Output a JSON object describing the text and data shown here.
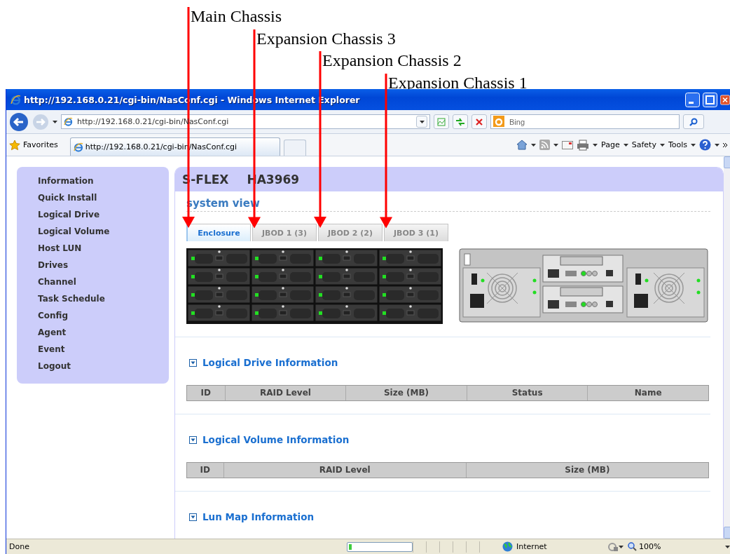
{
  "annotations": [
    {
      "label": "Main Chassis"
    },
    {
      "label": "Expansion Chassis 3"
    },
    {
      "label": "Expansion Chassis 2"
    },
    {
      "label": "Expansion Chassis 1"
    }
  ],
  "browser": {
    "title": "http://192.168.0.21/cgi-bin/NasConf.cgi - Windows Internet Explorer",
    "address": "http://192.168.0.21/cgi-bin/NasConf.cgi",
    "search_placeholder": "Bing",
    "favorites": "Favorites",
    "tab": "http://192.168.0.21/cgi-bin/NasConf.cgi",
    "commands": [
      "Page",
      "Safety",
      "Tools"
    ]
  },
  "sidebar": {
    "items": [
      "Information",
      "Quick Install",
      "Logical Drive",
      "Logical Volume",
      "Host LUN",
      "Drives",
      "Channel",
      "Task Schedule",
      "Config",
      "Agent",
      "Event",
      "Logout"
    ]
  },
  "header": {
    "brand": "S-FLEX",
    "model": "HA3969"
  },
  "system_view": {
    "title": "system view",
    "tabs": [
      {
        "label": "Enclosure",
        "selected": true
      },
      {
        "label": "JBOD 1 (3)",
        "selected": false
      },
      {
        "label": "JBOD 2 (2)",
        "selected": false
      },
      {
        "label": "JBOD 3 (1)",
        "selected": false
      }
    ]
  },
  "sections": [
    {
      "title": "Logical Drive Information",
      "columns": [
        "ID",
        "RAID Level",
        "Size (MB)",
        "Status",
        "Name"
      ]
    },
    {
      "title": "Logical Volume Information",
      "columns": [
        "ID",
        "RAID Level",
        "Size (MB)"
      ]
    },
    {
      "title": "Lun Map Information"
    }
  ],
  "status_bar": {
    "text": "Done",
    "progress": {
      "level": 0.04
    },
    "zone": "Internet",
    "zoom": "100%"
  }
}
